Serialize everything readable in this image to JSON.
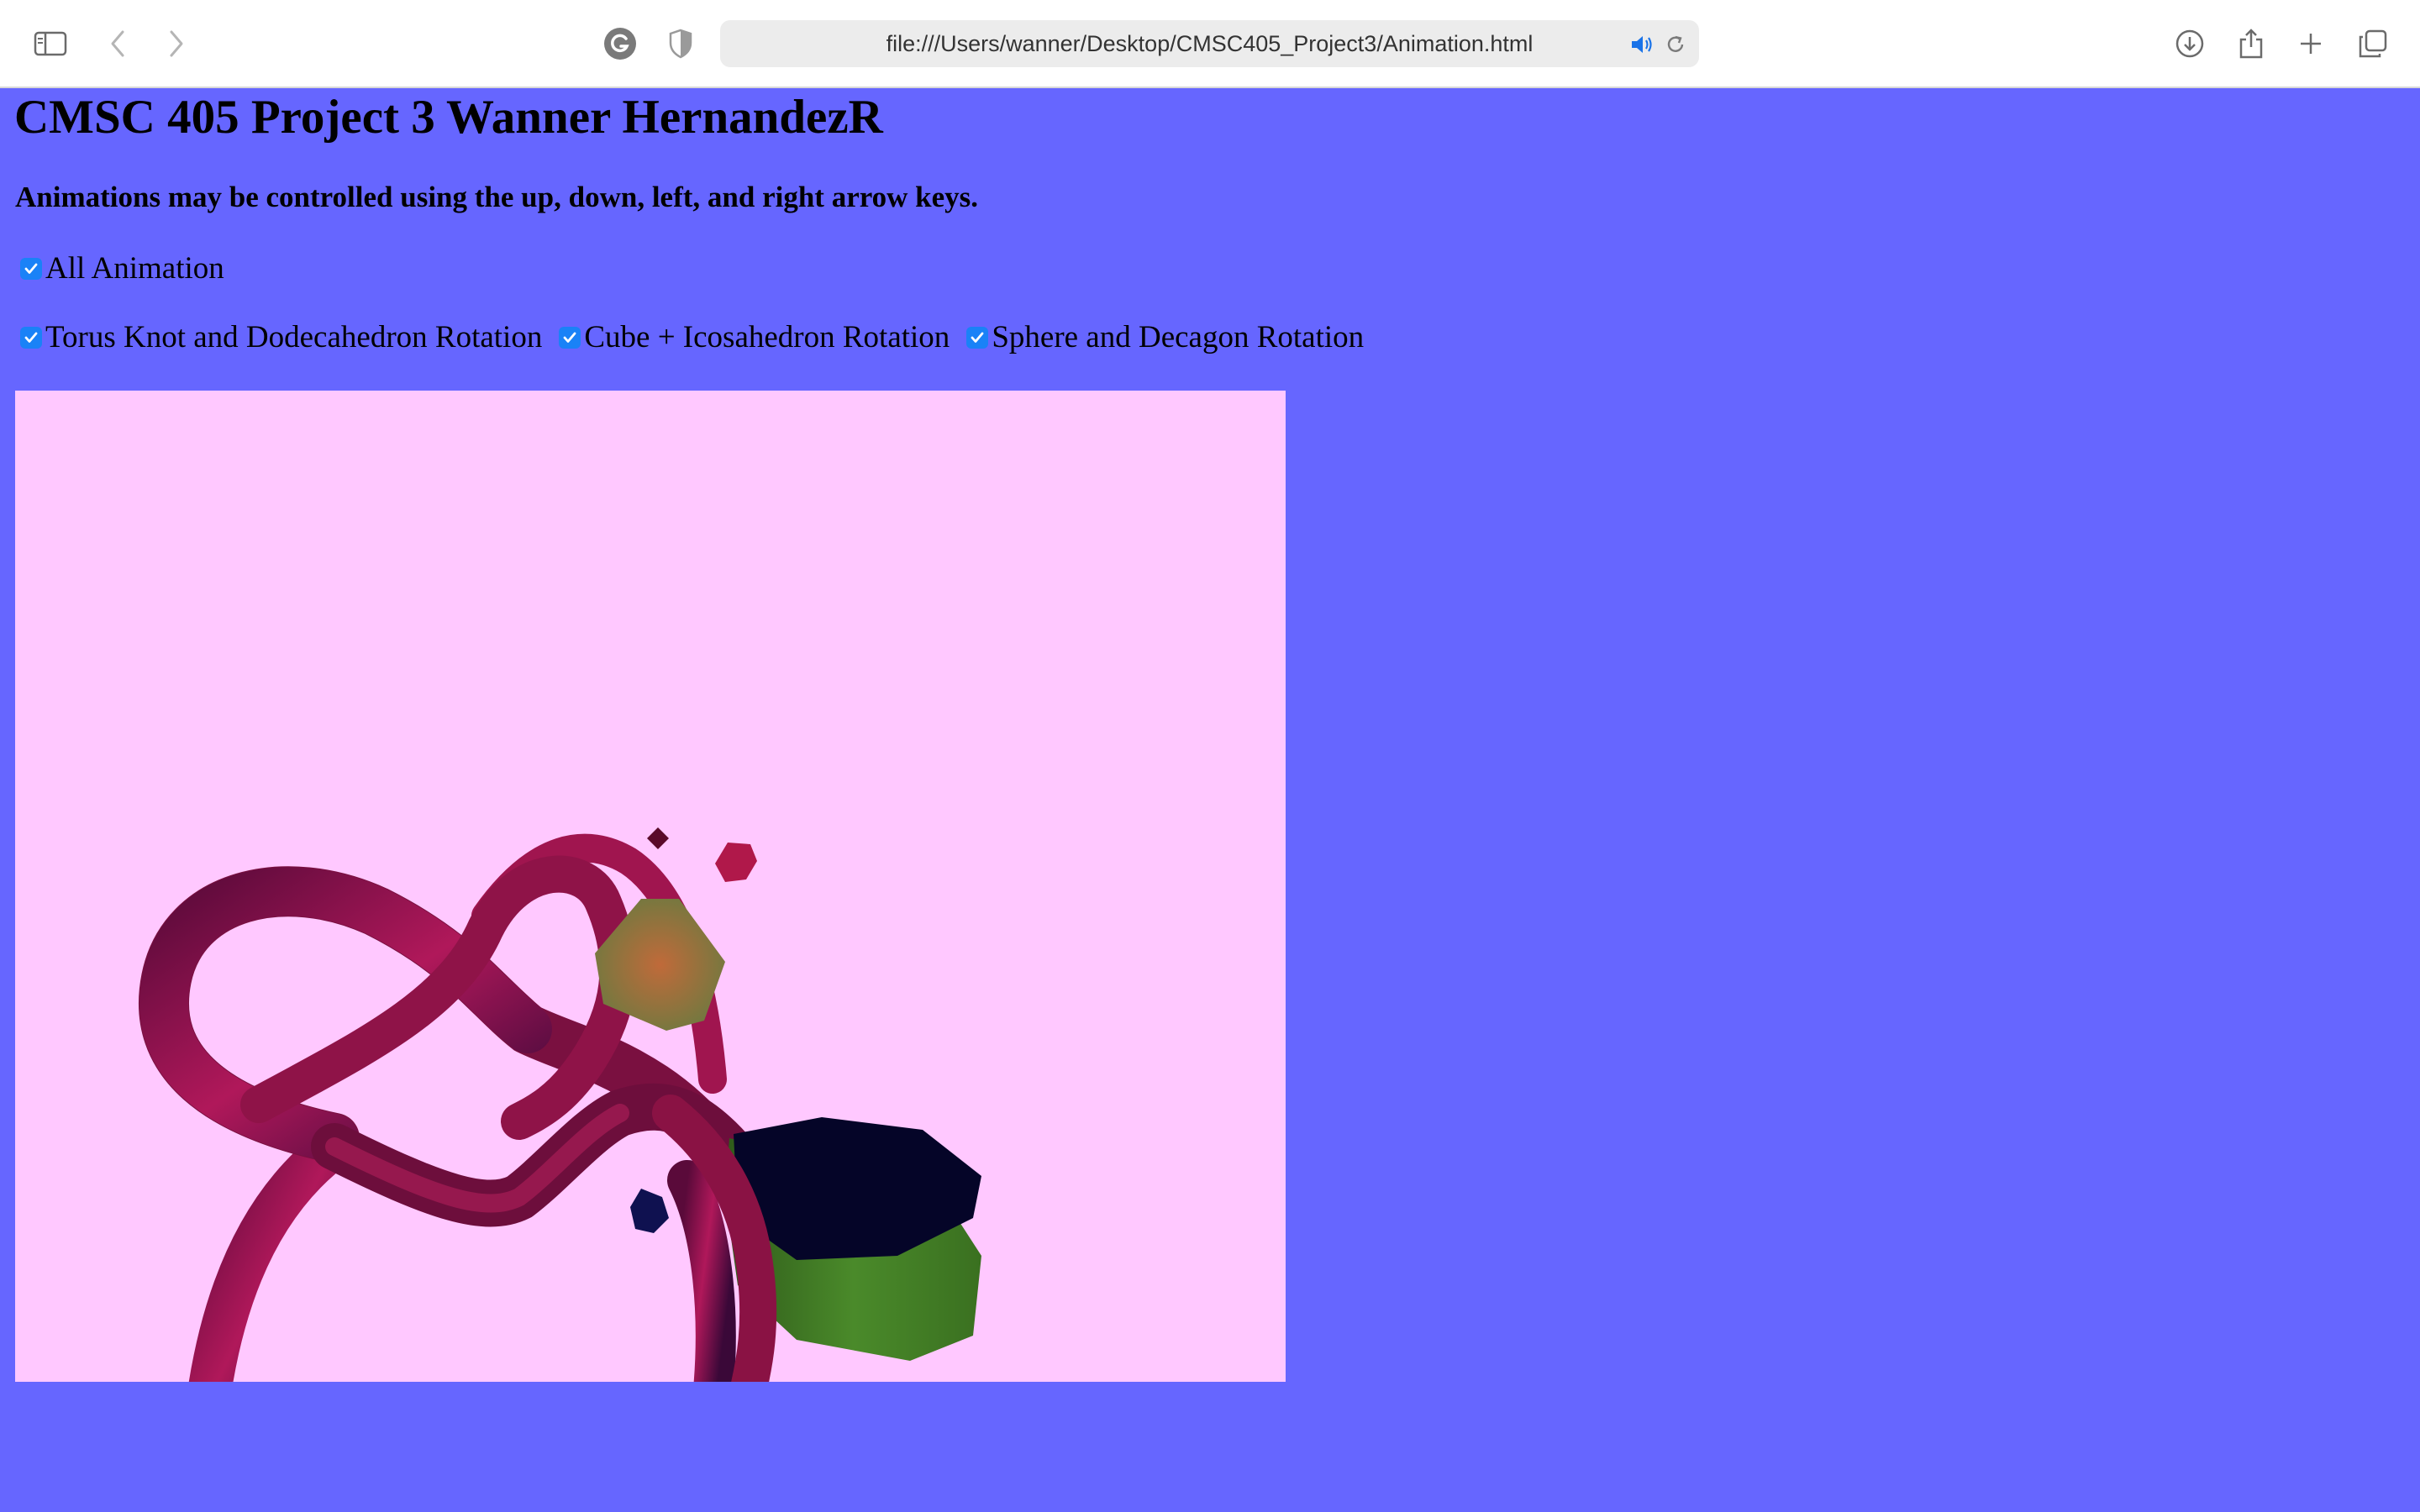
{
  "browser": {
    "url": "file:///Users/wanner/Desktop/CMSC405_Project3/Animation.html",
    "icons": [
      "sidebar-icon",
      "back-icon",
      "forward-icon",
      "grammarly-icon",
      "privacy-shield-icon",
      "speaker-icon",
      "reload-icon",
      "download-icon",
      "share-icon",
      "new-tab-icon",
      "tab-overview-icon"
    ]
  },
  "page": {
    "title": "CMSC 405 Project 3 Wanner HernandezR",
    "instructions": "Animations may be controlled using the up, down, left, and right arrow keys.",
    "all_animation": {
      "label": "All Animation",
      "checked": true
    },
    "toggles": [
      {
        "label": "Torus Knot and Dodecahedron Rotation",
        "checked": true
      },
      {
        "label": "Cube + Icosahedron Rotation",
        "checked": true
      },
      {
        "label": "Sphere and Decagon Rotation",
        "checked": true
      }
    ]
  },
  "colors": {
    "page_background": "#6666ff",
    "canvas_background": "#ffc8ff",
    "checkbox_accent": "#1a82f7",
    "torus_knot": "#a0154f",
    "prism": "#3f7a1f"
  }
}
